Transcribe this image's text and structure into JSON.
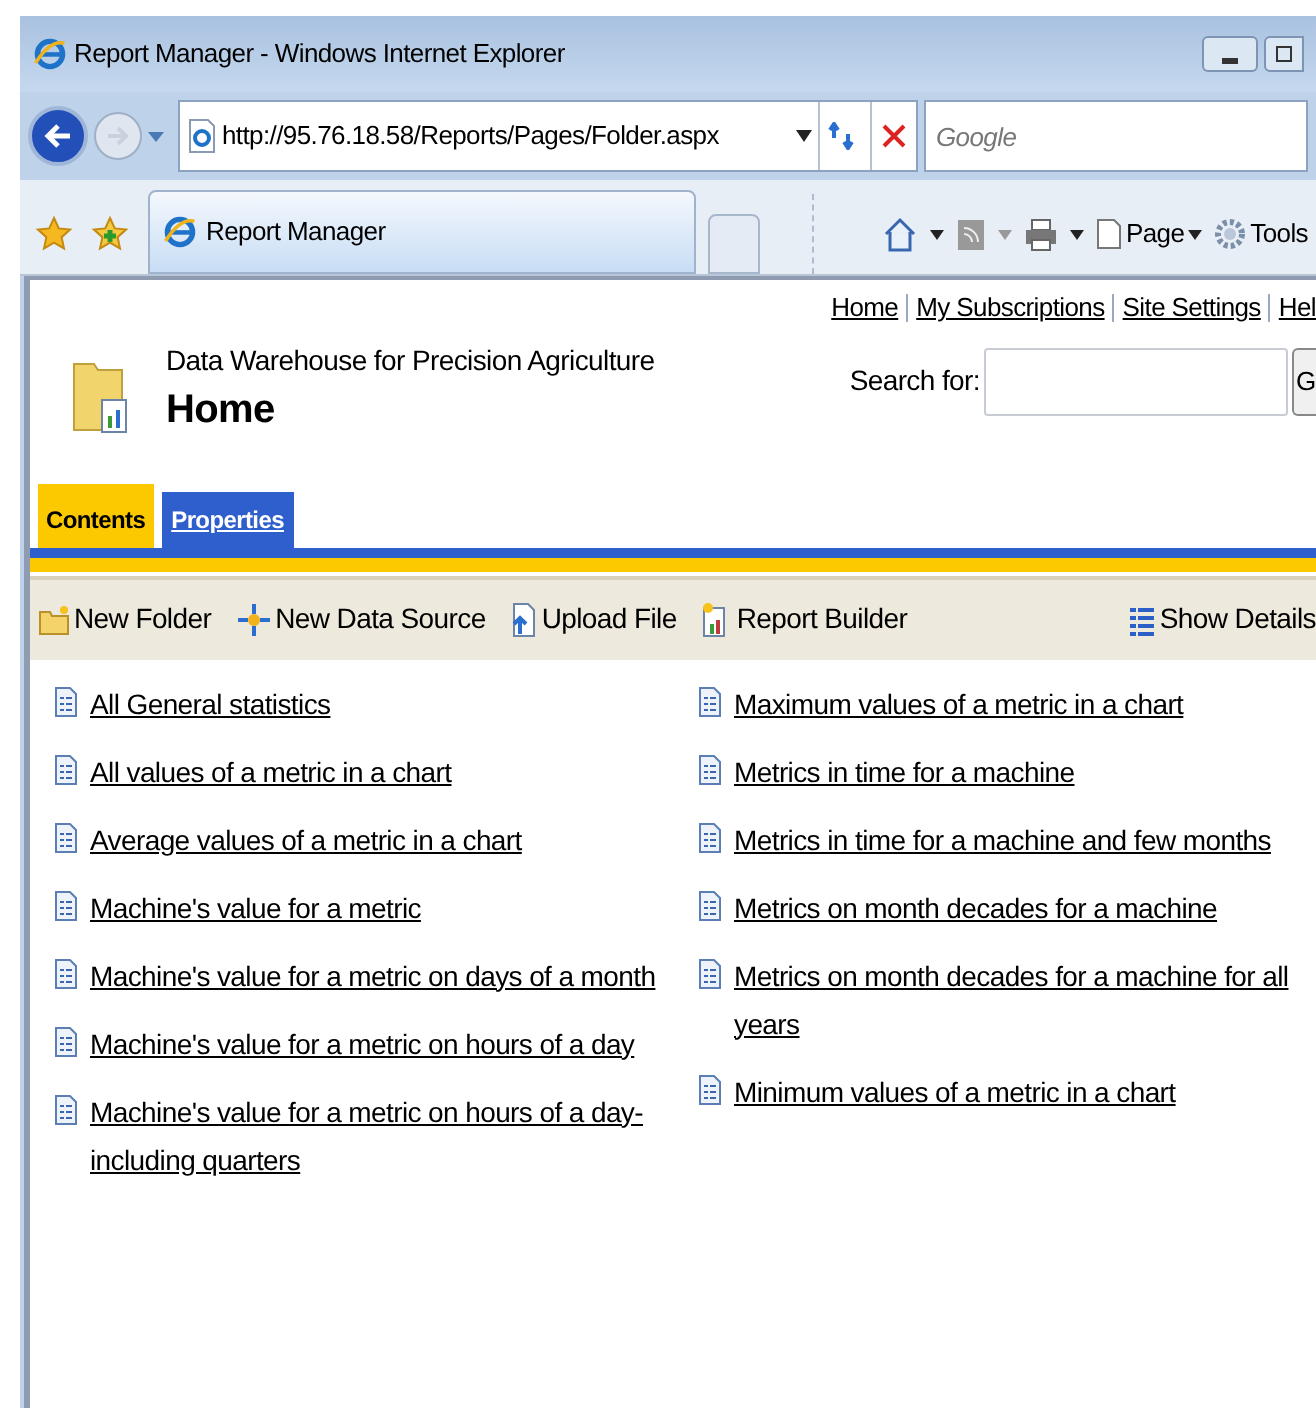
{
  "window": {
    "title": "Report Manager - Windows Internet Explorer"
  },
  "address_bar": {
    "url": "http://95.76.18.58/Reports/Pages/Folder.aspx"
  },
  "search_box": {
    "placeholder": "Google"
  },
  "browser_tab": {
    "label": "Report Manager"
  },
  "command_bar": [
    {
      "label": "Page"
    },
    {
      "label": "Tools"
    }
  ],
  "header_links": [
    "Home",
    "My Subscriptions",
    "Site Settings",
    "Hel"
  ],
  "site_name": "Data Warehouse for Precision Agriculture",
  "page_title": "Home",
  "search": {
    "label": "Search for:",
    "button": "G"
  },
  "tabs": [
    {
      "label": "Contents",
      "selected": true
    },
    {
      "label": "Properties",
      "selected": false
    }
  ],
  "toolbar": [
    {
      "label": "New Folder",
      "kind": "folder"
    },
    {
      "label": "New Data Source",
      "kind": "datasource"
    },
    {
      "label": "Upload File",
      "kind": "upload"
    },
    {
      "label": "Report Builder",
      "kind": "builder"
    },
    {
      "label": "Show Details",
      "kind": "details"
    }
  ],
  "reports": [
    [
      "All General statistics",
      "All values of a metric in a chart",
      "Average values of a metric in a chart",
      "Machine's value for a metric",
      "Machine's value for a metric on days of a month",
      "Machine's value for a metric on hours of a day",
      "Machine's value for a metric on hours of a day-including quarters"
    ],
    [
      "Maximum values of a metric in a chart",
      "Metrics in time for a machine",
      "Metrics in time for a machine and few months",
      "Metrics on month decades for a machine",
      "Metrics on month decades for a machine for all years",
      "Minimum values of a metric in a chart"
    ]
  ]
}
